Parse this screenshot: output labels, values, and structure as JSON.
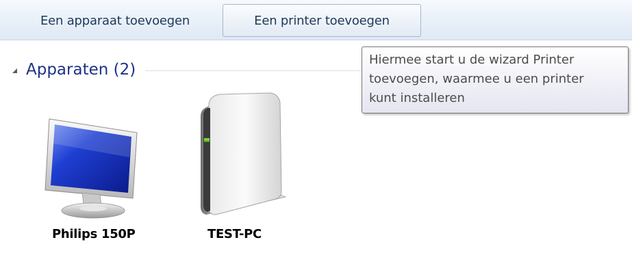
{
  "toolbar": {
    "add_device_label": "Een apparaat toevoegen",
    "add_printer_label": "Een printer toevoegen"
  },
  "group": {
    "title": "Apparaten (2)"
  },
  "devices": [
    {
      "name": "Philips 150P",
      "icon": "monitor-icon"
    },
    {
      "name": "TEST-PC",
      "icon": "computer-tower-icon"
    }
  ],
  "tooltip": {
    "lines": [
      "Hiermee start u de wizard Printer",
      "toevoegen, waarmee u een printer",
      "kunt installeren"
    ]
  },
  "colors": {
    "group_title": "#1e3287",
    "toolbar_text": "#1e395b",
    "monitor_screen": "#1a3fd0"
  }
}
